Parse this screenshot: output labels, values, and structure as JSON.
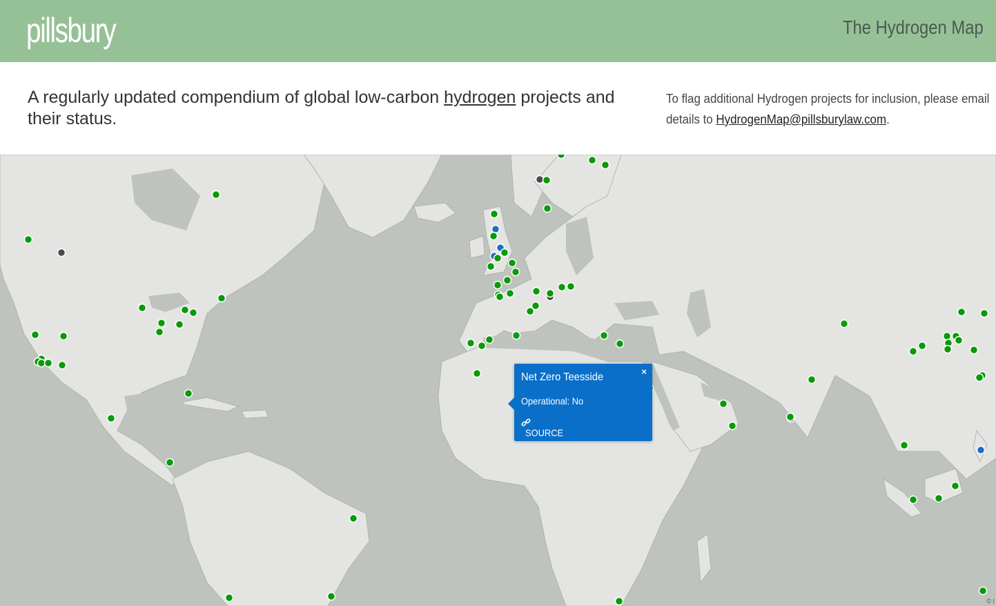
{
  "header": {
    "logo": "pillsbury",
    "site_title": "The Hydrogen Map",
    "bar_color": "#96c196"
  },
  "intro": {
    "text_before": "A regularly updated compendium of global low-carbon ",
    "link_text": "hydrogen",
    "text_after": " projects and their status."
  },
  "flag_note": {
    "line1": "To flag additional Hydrogen projects for inclusion, please email",
    "line2_prefix": "details to ",
    "email": "HydrogenMap@pillsburylaw.com",
    "line2_suffix": "."
  },
  "popup": {
    "title": "Net Zero Teesside",
    "status": "Operational: No",
    "source_label": "SOURCE",
    "close_label": "×",
    "color": "#0a6fc9"
  },
  "map": {
    "attribution": "© I",
    "marker_colors": {
      "green": "#0a9a0a",
      "blue": "#1a6fc4",
      "gray": "#4a4a4a"
    },
    "land_color": "#e4e5e2",
    "water_color": "#bfc3be"
  }
}
